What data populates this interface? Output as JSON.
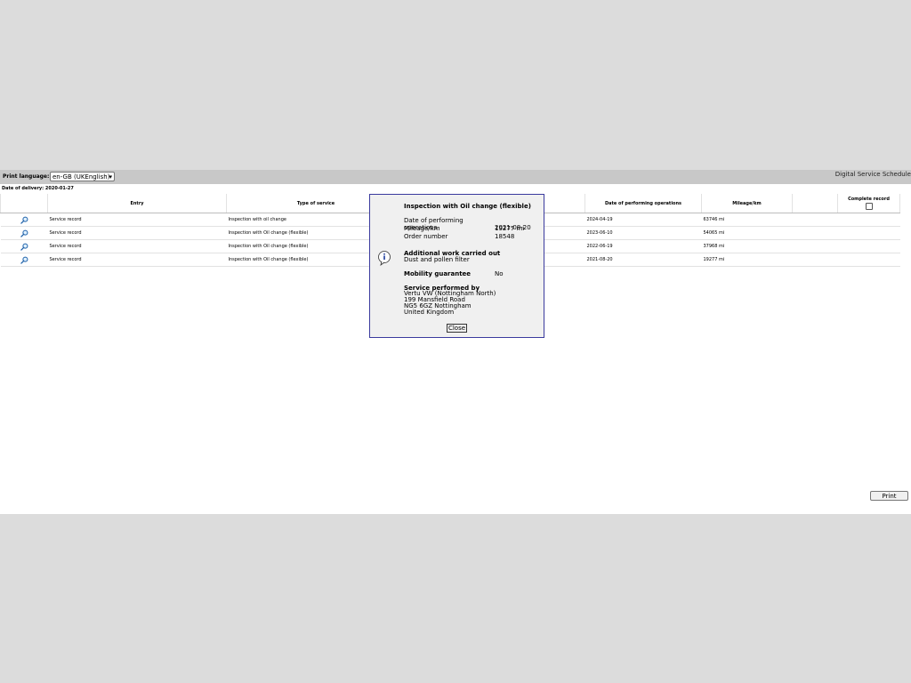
{
  "toolbar": {
    "print_language_label": "Print language:",
    "print_language_value": "en-GB (UKEnglish)",
    "app_title": "Digital Service Schedule"
  },
  "delivery": "Date of delivery: 2020-01-27",
  "table": {
    "headers": [
      "",
      "Entry",
      "Type of service",
      "",
      "Date of performing operations",
      "Mileage/km",
      "",
      "Complete record"
    ],
    "rows": [
      {
        "entry": "Service record",
        "type": "Inspection with oil change",
        "date": "2024-04-19",
        "mileage": "63746 mi"
      },
      {
        "entry": "Service record",
        "type": "Inspection with Oil change (flexible)",
        "date": "2023-06-10",
        "mileage": "54065 mi"
      },
      {
        "entry": "Service record",
        "type": "Inspection with Oil change (flexible)",
        "date": "2022-06-19",
        "mileage": "37968 mi"
      },
      {
        "entry": "Service record",
        "type": "Inspection with Oil change (flexible)",
        "date": "2021-08-20",
        "mileage": "19277 mi"
      }
    ]
  },
  "popup": {
    "title": "Inspection with Oil change (flexible)",
    "date_label": "Date of performing operations",
    "date_value": "2021-08-20",
    "mileage_label": "Mileage/km",
    "mileage_value": "19277 mi",
    "order_label": "Order number",
    "order_value": "18548",
    "additional_title": "Additional work carried out",
    "additional_text": "Dust and pollen filter",
    "mobility_label": "Mobility guarantee",
    "mobility_value": "No",
    "performed_title": "Service performed by",
    "address_lines": [
      "Vertu VW (Nottingham North)",
      "199 Mansfield Road",
      "NG5 6GZ Nottingham",
      "United Kingdom"
    ],
    "close_label": "Close"
  },
  "print_button": "Print"
}
